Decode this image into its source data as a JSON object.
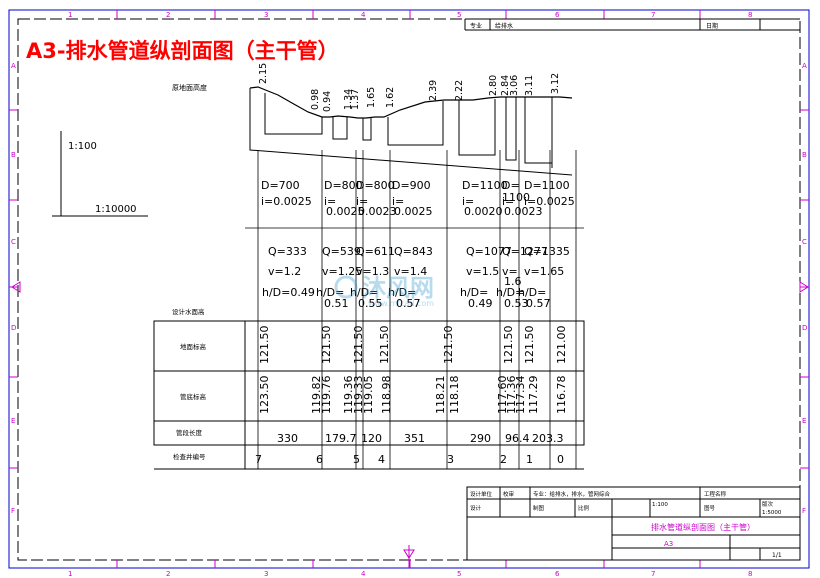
{
  "title": "A3-排水管道纵剖面图（主干管）",
  "colors": {
    "frame": "#0000cc",
    "title": "#ff0000",
    "ink": "#000000",
    "zone": "#cc00cc"
  },
  "top_ruler": [
    "1",
    "2",
    "3",
    "4",
    "5",
    "6",
    "7",
    "8"
  ],
  "bottom_ruler": [
    "1",
    "2",
    "3",
    "4",
    "5",
    "6",
    "7",
    "8"
  ],
  "side_ruler": [
    "A",
    "B",
    "C",
    "D",
    "E",
    "F"
  ],
  "top_strip": {
    "left": "专业",
    "left_value": "给排水",
    "right": "日期"
  },
  "scales": {
    "vertical": "1:100",
    "horizontal": "1:10000"
  },
  "labels": {
    "ground_elev_top": "原地面高度",
    "design_flow_level": "设计水面高",
    "ground_elev": "地面标高",
    "invert_elev": "管底标高",
    "length": "管段长度",
    "node_no": "检查井编号"
  },
  "top_elevations": [
    "2.15",
    "0.98",
    "0.94",
    "1.34",
    "1.37",
    "1.65",
    "1.62",
    "2.39",
    "2.22",
    "2.80",
    "2.84",
    "3.06",
    "3.11",
    "3.12"
  ],
  "diameter": [
    {
      "d": "D=700",
      "i": "i=0.0025"
    },
    {
      "d": "D=800",
      "i": "i=",
      "i2": "0.0025"
    },
    {
      "d": "D=800",
      "i": "i=",
      "i2": "0.0023"
    },
    {
      "d": "D=900",
      "i": "i=",
      "i2": "0.0025"
    },
    {
      "d": "D=1100",
      "i": "i=",
      "i2": "0.0020"
    },
    {
      "d": "D=",
      "d2": "1100",
      "i": "i=",
      "i2": "0.0023"
    },
    {
      "d": "D=1100",
      "i": "i=0.0025"
    }
  ],
  "flow": [
    {
      "q": "Q=333",
      "v": "v=1.2",
      "h": "h/D=0.49"
    },
    {
      "q": "Q=539",
      "v": "v=1.25",
      "h": "h/D=",
      "h2": "0.51"
    },
    {
      "q": "Q=611",
      "v": "v=1.3",
      "h": "h/D=",
      "h2": "0.55"
    },
    {
      "q": "Q=843",
      "v": "v=1.4",
      "h": "h/D=",
      "h2": "0.57"
    },
    {
      "q": "Q=1077",
      "v": "v=1.5",
      "h": "h/D=",
      "h2": "0.49"
    },
    {
      "q": "Q=1277",
      "v": "v=",
      "v2": "1.6",
      "h": "h/D=",
      "h2": "0.53"
    },
    {
      "q": "Q=1335",
      "v": "v=1.65",
      "h": "h/D=",
      "h2": "0.57"
    }
  ],
  "ground_row": [
    "121.50",
    "121.50",
    "121.50",
    "121.50",
    "121.50",
    "121.50",
    "121.50",
    "121.00"
  ],
  "invert_row": [
    "123.50",
    "119.82",
    "119.76",
    "119.36",
    "119.33",
    "119.05",
    "118.98",
    "118.21",
    "118.18",
    "117.60",
    "117.36",
    "117.34",
    "117.29",
    "116.78"
  ],
  "lengths": [
    "330",
    "179.7",
    "120",
    "351",
    "290",
    "96.4",
    "203.3"
  ],
  "nodes": [
    "7",
    "6",
    "5",
    "4",
    "3",
    "2",
    "1",
    "0"
  ],
  "title_block": {
    "r1": [
      "设计单位",
      "校审",
      "专业：给排水，排水，管网综合",
      "工程名称"
    ],
    "r2": [
      "设计",
      "制图",
      "比例",
      "图号",
      "版次"
    ],
    "scale_v": "1:100",
    "scale_h": "1:5000",
    "drawing_name": "排水管道纵剖面图（主干管）",
    "sheet_size": "A3",
    "sheet": "1/1"
  },
  "watermark": {
    "brand": "沐风网",
    "url": "www.mfcad.com"
  }
}
